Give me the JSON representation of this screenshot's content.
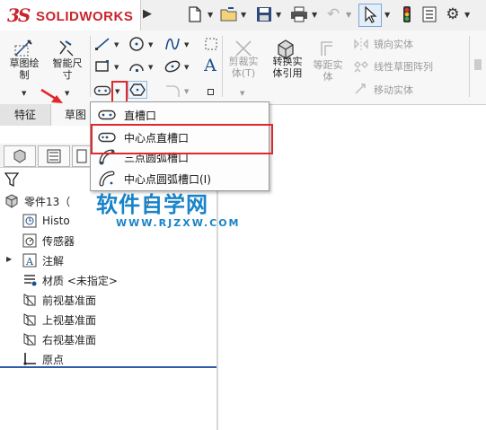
{
  "app": {
    "logo_mark": "3S",
    "logo_text": "SOLIDWORKS"
  },
  "titlebar": {
    "icons": [
      "new-document-icon",
      "open-folder-icon",
      "save-icon",
      "print-icon",
      "undo-icon",
      "select-cursor-icon",
      "traffic-light-icon",
      "file-properties-icon",
      "gear-icon"
    ]
  },
  "ribbon": {
    "sketch_label": "草图绘\n制",
    "smart_dim_label": "智能尺\n寸",
    "trim_label": "剪裁实\n体(T)",
    "convert_label": "转换实\n体引用",
    "offset_label": "等距实\n体",
    "mirror_label": "镜向实体",
    "linear_pattern_label": "线性草图阵列",
    "move_label": "移动实体"
  },
  "tabs": {
    "feature": "特征",
    "sketch": "草图"
  },
  "dropdown": {
    "items": [
      {
        "label": "直槽口",
        "icon": "straight-slot-icon"
      },
      {
        "label": "中心点直槽口",
        "icon": "centerpoint-straight-slot-icon"
      },
      {
        "label": "三点圆弧槽口",
        "icon": "three-point-arc-slot-icon"
      },
      {
        "label": "中心点圆弧槽口(I)",
        "icon": "centerpoint-arc-slot-icon"
      }
    ]
  },
  "tree": {
    "part": "零件13（",
    "part_tail": "）",
    "history": "Histo",
    "sensors": "传感器",
    "annotations": "注解",
    "material": "材质 <未指定>",
    "front_plane": "前视基准面",
    "top_plane": "上视基准面",
    "right_plane": "右视基准面",
    "origin": "原点"
  },
  "watermark": {
    "main": "软件自学网",
    "sub": "WWW.RJZXW.COM"
  },
  "colors": {
    "brand_red": "#c9242b",
    "highlight_red": "#e0282d",
    "watermark_blue": "#1883c9",
    "icon_blue": "#1e4e8c"
  }
}
